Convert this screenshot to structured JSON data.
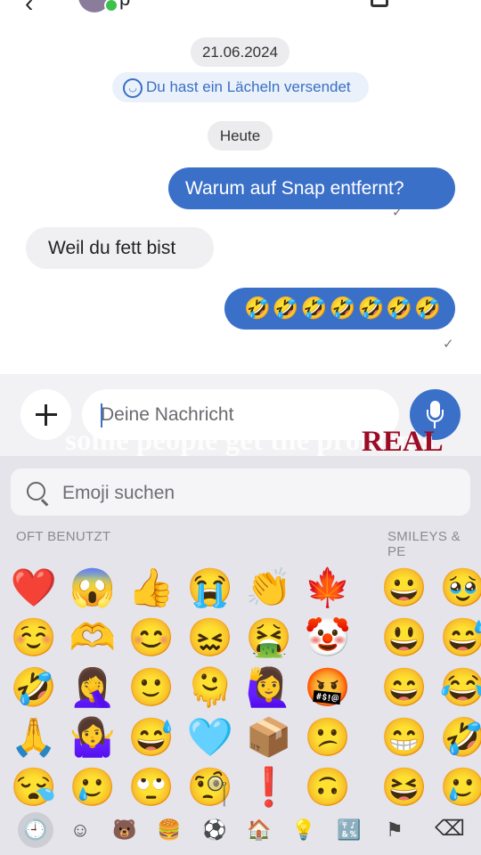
{
  "header": {
    "back_icon": "arrow-left-icon",
    "contact_name": "p"
  },
  "chat": {
    "date": "21.06.2024",
    "event": "Du hast ein Lächeln versendet",
    "today": "Heute",
    "messages": [
      {
        "direction": "out",
        "text": "Warum auf Snap entfernt?",
        "status": "✓"
      },
      {
        "direction": "in",
        "text": "Weil du fett bist"
      },
      {
        "direction": "out",
        "text": "🤣🤣🤣🤣🤣🤣🤣",
        "status": "✓"
      }
    ]
  },
  "composer": {
    "plus_label": "+",
    "placeholder": "Deine Nachricht"
  },
  "overlay": {
    "text": "some people get the problems",
    "highlight": "REAL"
  },
  "keyboard": {
    "search_placeholder": "Emoji suchen",
    "sections": [
      "OFT BENUTZT",
      "SMILEYS & PE"
    ],
    "emojis": [
      "❤️",
      "😱",
      "👍",
      "😭",
      "👏",
      "🍁",
      "😀",
      "🥹",
      "☺️",
      "🫶",
      "😊",
      "😖",
      "🤮",
      "🤡",
      "😃",
      "😅",
      "🤣",
      "🤦‍♀️",
      "🙂",
      "🫠",
      "🙋‍♀️",
      "🤬",
      "😄",
      "😂",
      "🙏",
      "🤷‍♀️",
      "😅",
      "🩵",
      "📦",
      "😕",
      "😁",
      "🤣",
      "😪",
      "🥲",
      "🙄",
      "🧐",
      "❗",
      "🙃",
      "😆",
      "🥲"
    ],
    "categories": [
      "🕘",
      "☺",
      "🐻",
      "🍔",
      "⚽",
      "🏠",
      "💡",
      "🔣",
      "⚑"
    ],
    "delete_label": "⌫"
  }
}
